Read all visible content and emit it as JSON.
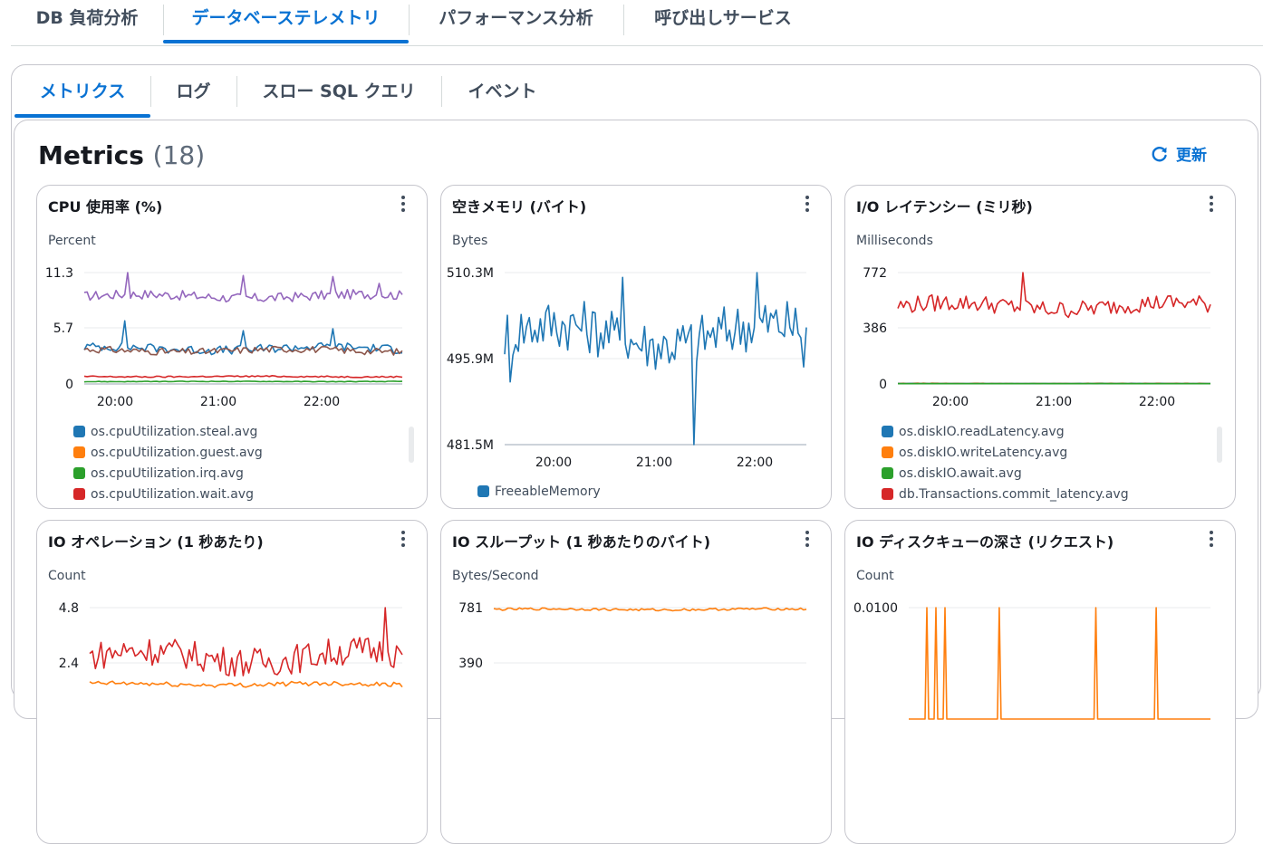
{
  "top_tabs": [
    {
      "label": "DB 負荷分析"
    },
    {
      "label": "データベーステレメトリ"
    },
    {
      "label": "パフォーマンス分析"
    },
    {
      "label": "呼び出しサービス"
    }
  ],
  "sub_tabs": [
    {
      "label": "メトリクス"
    },
    {
      "label": "ログ"
    },
    {
      "label": "スロー SQL クエリ"
    },
    {
      "label": "イベント"
    }
  ],
  "metrics": {
    "title": "Metrics",
    "count": "(18)",
    "refresh_label": "更新"
  },
  "colors": {
    "accent": "#0972d3",
    "blue": "#1f77b4",
    "orange": "#ff7f0e",
    "green": "#2ca02c",
    "red": "#d62728",
    "purple": "#9467bd",
    "brown": "#8c564b"
  },
  "cards": [
    {
      "title": "CPU 使用率 (%)",
      "unit": "Percent",
      "legend": [
        "os.cpuUtilization.steal.avg",
        "os.cpuUtilization.guest.avg",
        "os.cpuUtilization.irq.avg",
        "os.cpuUtilization.wait.avg"
      ]
    },
    {
      "title": "空きメモリ (バイト)",
      "unit": "Bytes",
      "legend": [
        "FreeableMemory"
      ]
    },
    {
      "title": "I/O レイテンシー (ミリ秒)",
      "unit": "Milliseconds",
      "legend": [
        "os.diskIO.readLatency.avg",
        "os.diskIO.writeLatency.avg",
        "os.diskIO.await.avg",
        "db.Transactions.commit_latency.avg"
      ]
    },
    {
      "title": "IO オペレーション (1 秒あたり)",
      "unit": "Count",
      "legend": []
    },
    {
      "title": "IO スループット (1 秒あたりのバイト)",
      "unit": "Bytes/Second",
      "legend": []
    },
    {
      "title": "IO ディスクキューの深さ (リクエスト)",
      "unit": "Count",
      "legend": []
    }
  ],
  "chart_data": [
    {
      "type": "line",
      "title": "CPU 使用率 (%)",
      "ylabel": "Percent",
      "y_ticks": [
        "11.3",
        "5.7",
        "0"
      ],
      "x_ticks": [
        "20:00",
        "21:00",
        "22:00"
      ],
      "ylim": [
        0,
        11.3
      ],
      "series": [
        {
          "color": "purple",
          "level": 8.9,
          "noise": 0.5,
          "spikes": [
            [
              0.14,
              11.3
            ],
            [
              0.5,
              11
            ],
            [
              0.78,
              10.9
            ],
            [
              0.93,
              10.2
            ]
          ]
        },
        {
          "color": "blue",
          "level": 3.6,
          "noise": 0.45,
          "spikes": [
            [
              0.13,
              6.4
            ],
            [
              0.5,
              5.4
            ],
            [
              0.78,
              5.6
            ]
          ]
        },
        {
          "color": "brown",
          "level": 3.4,
          "noise": 0.35,
          "spikes": []
        },
        {
          "color": "red",
          "level": 0.75,
          "noise": 0.07,
          "spikes": []
        },
        {
          "color": "green",
          "level": 0.25,
          "noise": 0.03,
          "spikes": []
        }
      ]
    },
    {
      "type": "line",
      "title": "空きメモリ (バイト)",
      "ylabel": "Bytes",
      "y_ticks": [
        "510.3M",
        "495.9M",
        "481.5M"
      ],
      "x_ticks": [
        "20:00",
        "21:00",
        "22:00"
      ],
      "ylim": [
        481.5,
        510.3
      ],
      "series": [
        {
          "color": "blue",
          "level": 500,
          "noise": 4.5,
          "spikes": [
            [
              0.63,
              481.5
            ],
            [
              0.39,
              509.5
            ],
            [
              0.84,
              510.3
            ],
            [
              0.02,
              492
            ],
            [
              0.99,
              494.5
            ]
          ]
        }
      ]
    },
    {
      "type": "line",
      "title": "I/O レイテンシー (ミリ秒)",
      "ylabel": "Milliseconds",
      "y_ticks": [
        "772",
        "386",
        "0"
      ],
      "x_ticks": [
        "20:00",
        "21:00",
        "22:00"
      ],
      "ylim": [
        0,
        772
      ],
      "series": [
        {
          "color": "red",
          "level": 540,
          "noise": 60,
          "spikes": [
            [
              0.4,
              772
            ]
          ]
        },
        {
          "color": "orange",
          "level": 4,
          "noise": 1,
          "spikes": []
        },
        {
          "color": "blue",
          "level": 3,
          "noise": 0.5,
          "spikes": []
        },
        {
          "color": "green",
          "level": 2,
          "noise": 0.3,
          "spikes": []
        }
      ]
    },
    {
      "type": "line",
      "title": "IO オペレーション (1 秒あたり)",
      "ylabel": "Count",
      "y_ticks": [
        "4.8",
        "2.4"
      ],
      "x_ticks": [],
      "ylim": [
        2.4,
        4.8
      ],
      "series": [
        {
          "color": "red",
          "level": 3.75,
          "noise": 0.32,
          "spikes": [
            [
              0.95,
              4.8
            ]
          ]
        },
        {
          "color": "orange",
          "level": 3.15,
          "noise": 0.05,
          "spikes": []
        }
      ]
    },
    {
      "type": "line",
      "title": "IO スループット (1 秒あたりのバイト)",
      "ylabel": "Bytes/Second",
      "y_ticks": [
        "781",
        "390"
      ],
      "x_ticks": [],
      "ylim": [
        390,
        781
      ],
      "series": [
        {
          "color": "orange",
          "level": 775,
          "noise": 4,
          "spikes": []
        }
      ]
    },
    {
      "type": "line",
      "title": "IO ディスクキューの深さ (リクエスト)",
      "ylabel": "Count",
      "y_ticks": [
        "0.0100"
      ],
      "x_ticks": [],
      "ylim": [
        0,
        0.01
      ],
      "series": [
        {
          "color": "orange",
          "level": 0,
          "noise": 0,
          "spike_x": [
            0.06,
            0.09,
            0.12,
            0.3,
            0.62,
            0.82
          ]
        }
      ]
    }
  ]
}
